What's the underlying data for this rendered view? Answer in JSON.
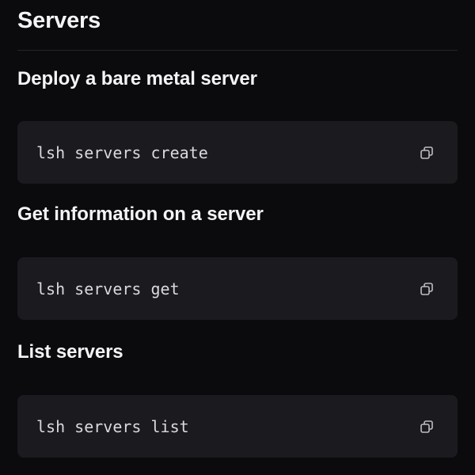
{
  "section": {
    "title": "Servers"
  },
  "commands": [
    {
      "heading": "Deploy a bare metal server",
      "code": "lsh servers create",
      "icon": "copy-icon"
    },
    {
      "heading": "Get information on a server",
      "code": "lsh servers get",
      "icon": "copy-icon"
    },
    {
      "heading": "List servers",
      "code": "lsh servers list",
      "icon": "copy-icon"
    }
  ],
  "colors": {
    "background": "#0b0b0d",
    "code_background": "#1b1b1f",
    "text": "#f4f4f6",
    "code_text": "#d9d9de",
    "divider": "#25252b"
  }
}
